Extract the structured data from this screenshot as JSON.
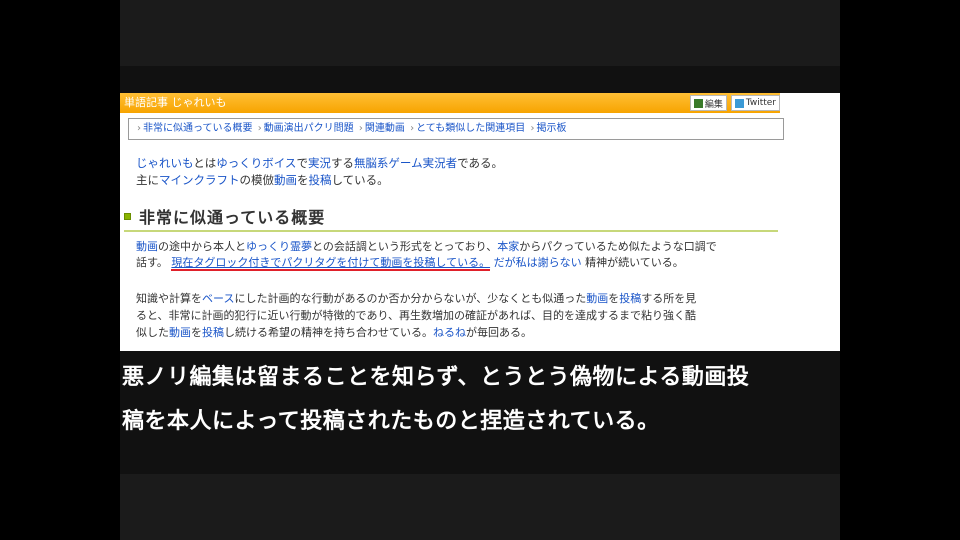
{
  "header": {
    "title_a": "単語記事",
    "title_b": "じゃれいも",
    "tools": [
      {
        "label": "編集",
        "color": "#3a7a2a"
      },
      {
        "label": "Twitter",
        "color": "#3b9ad6"
      }
    ]
  },
  "toc": [
    "非常に似通っている概要",
    "動画演出パクリ問題",
    "関連動画",
    "とても類似した関連項目",
    "掲示板"
  ],
  "intro": {
    "line1": [
      {
        "t": "じゃれいも",
        "link": true
      },
      {
        "t": "とは",
        "link": false
      },
      {
        "t": "ゆっくりボイス",
        "link": true
      },
      {
        "t": "で",
        "link": false
      },
      {
        "t": "実況",
        "link": true
      },
      {
        "t": "する",
        "link": false
      },
      {
        "t": "無脳系ゲーム実況者",
        "link": true
      },
      {
        "t": "である。",
        "link": false
      }
    ],
    "line2": [
      {
        "t": "主に",
        "link": false
      },
      {
        "t": "マインクラフト",
        "link": true
      },
      {
        "t": "の模倣",
        "link": false
      },
      {
        "t": "動画",
        "link": true
      },
      {
        "t": "を",
        "link": false
      },
      {
        "t": "投稿",
        "link": true
      },
      {
        "t": "している。",
        "link": false
      }
    ]
  },
  "section": {
    "heading": "非常に似通っている概要"
  },
  "para1": {
    "line1": [
      {
        "t": "動画",
        "link": true
      },
      {
        "t": "の途中から本人と",
        "link": false
      },
      {
        "t": "ゆっくり霊夢",
        "link": true
      },
      {
        "t": "との会話調という形式をとっており、",
        "link": false
      },
      {
        "t": "本家",
        "link": true
      },
      {
        "t": "からパクっているため似たような口調で",
        "link": false
      }
    ],
    "line2_prefix": "話す。",
    "line2_highlight": "現在タグロック付きでパクリタグを付けて動画を投稿している。",
    "line2_link": "だが私は謝らない",
    "line2_suffix": "精神が続いている。"
  },
  "para2": {
    "line1": [
      {
        "t": "知識や計算を",
        "link": false
      },
      {
        "t": "ベース",
        "link": true
      },
      {
        "t": "にした計画的な行動があるのか否か分からないが、少なくとも似通った",
        "link": false
      },
      {
        "t": "動画",
        "link": true
      },
      {
        "t": "を",
        "link": false
      },
      {
        "t": "投稿",
        "link": true
      },
      {
        "t": "する所を見",
        "link": false
      }
    ],
    "line2": [
      {
        "t": "ると、非常に計画的犯行に近い行動が特徴的であり、再生数増加の確証があれば、目的を達成するまで粘り強く酷",
        "link": false
      }
    ],
    "line3": [
      {
        "t": "似した",
        "link": false
      },
      {
        "t": "動画",
        "link": true
      },
      {
        "t": "を",
        "link": false
      },
      {
        "t": "投稿",
        "link": true
      },
      {
        "t": "し続ける希望の精神を持ち合わせている。",
        "link": false
      },
      {
        "t": "ねるね",
        "link": true
      },
      {
        "t": "が毎回ある。",
        "link": false
      }
    ]
  },
  "subtitle": {
    "line1": "悪ノリ編集は留まることを知らず、とうとう偽物による動画投",
    "line2": "稿を本人によって投稿されたものと捏造されている。"
  }
}
